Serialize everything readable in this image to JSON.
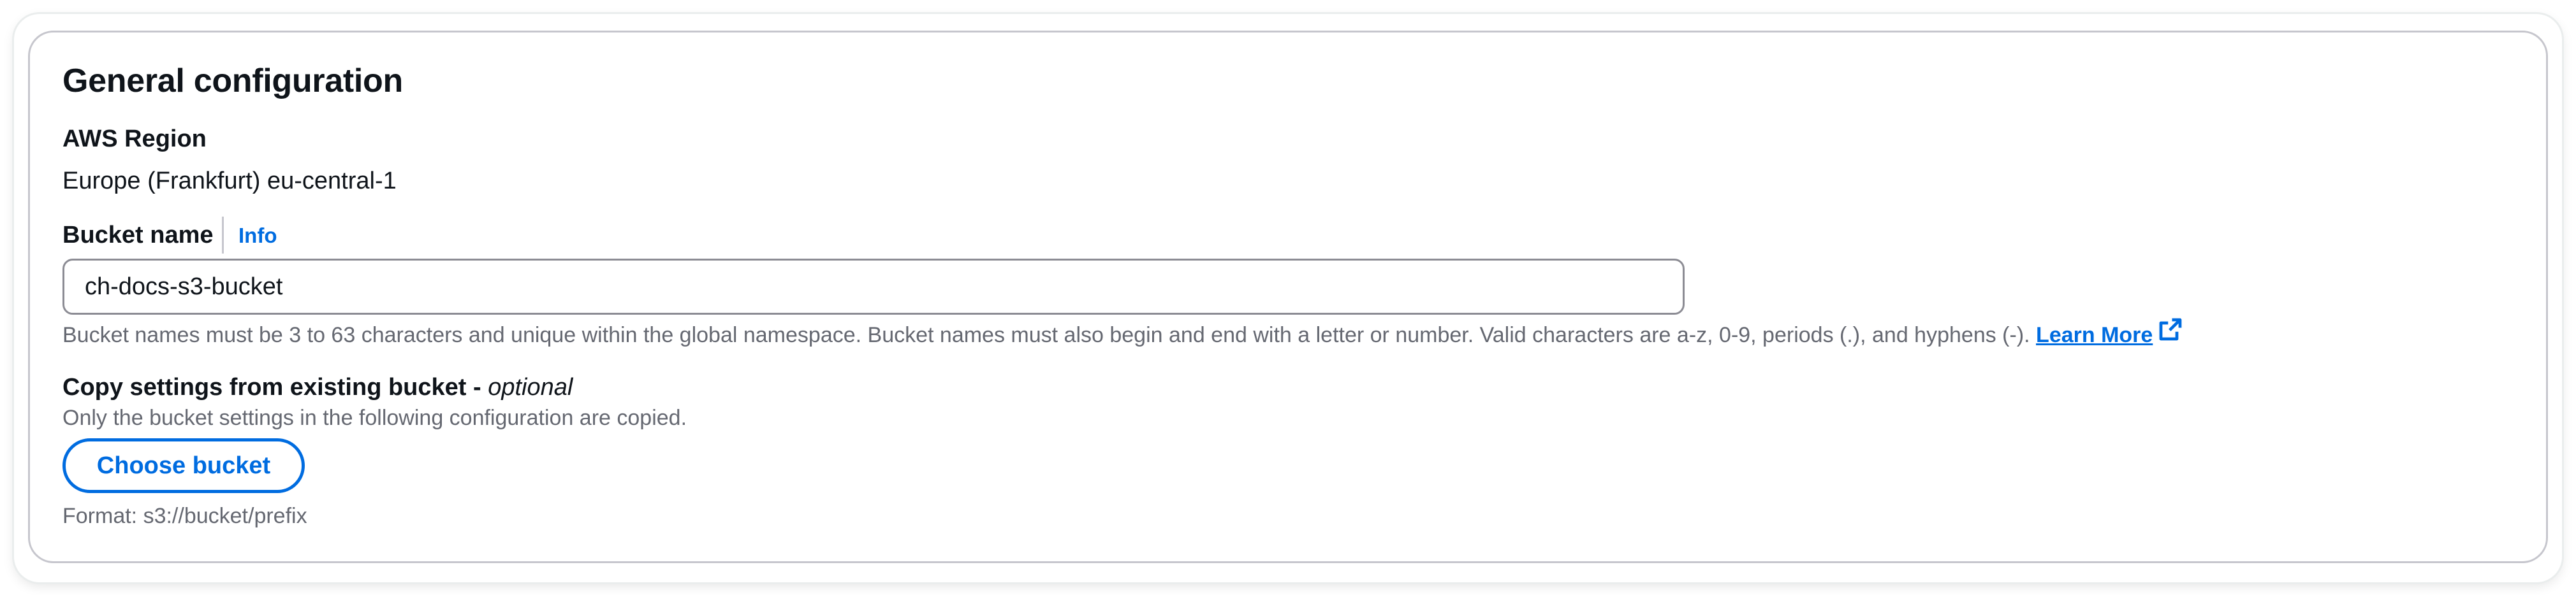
{
  "section": {
    "title": "General configuration"
  },
  "region": {
    "label": "AWS Region",
    "value": "Europe (Frankfurt) eu-central-1"
  },
  "bucket_name": {
    "label": "Bucket name",
    "info_link": "Info",
    "value": "ch-docs-s3-bucket",
    "hint": "Bucket names must be 3 to 63 characters and unique within the global namespace. Bucket names must also begin and end with a letter or number. Valid characters are a-z, 0-9, periods (.), and hyphens (-).",
    "learn_more": "Learn More",
    "learn_more_icon": "external-link-icon"
  },
  "copy_settings": {
    "label": "Copy settings from existing bucket - ",
    "label_optional": "optional",
    "description": "Only the bucket settings in the following configuration are copied.",
    "button_label": "Choose bucket",
    "format_hint": "Format: s3://bucket/prefix"
  },
  "colors": {
    "link": "#006ce0",
    "text": "#0f141a",
    "secondary_text": "#656871",
    "border": "#c6c6cd",
    "input_border": "#8c8c94"
  }
}
